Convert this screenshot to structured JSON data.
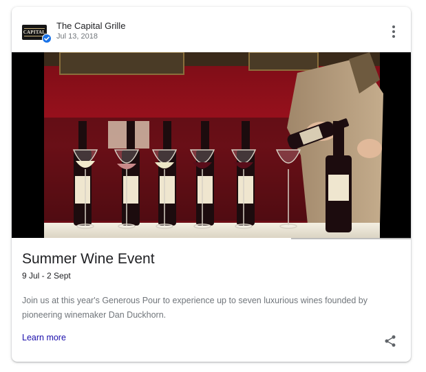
{
  "post": {
    "business_name": "The Capital Grille",
    "date": "Jul 13, 2018",
    "logo_text": "CAPITAL",
    "title": "Summer Wine Event",
    "event_dates": "9 Jul - 2 Sept",
    "description": "Join us at this year's Generous Pour to experience up to seven luxurious wines founded by pioneering winemaker Dan Duckhorn.",
    "learn_more": "Learn more",
    "video_progress": 0.7
  },
  "icons": {
    "verified": "verified-badge-icon",
    "more": "more-vert-icon",
    "share": "share-icon"
  },
  "colors": {
    "verified": "#1a73e8",
    "link": "#1a0dab",
    "title": "#202124",
    "muted": "#70757a",
    "wall": "#a3121f"
  }
}
